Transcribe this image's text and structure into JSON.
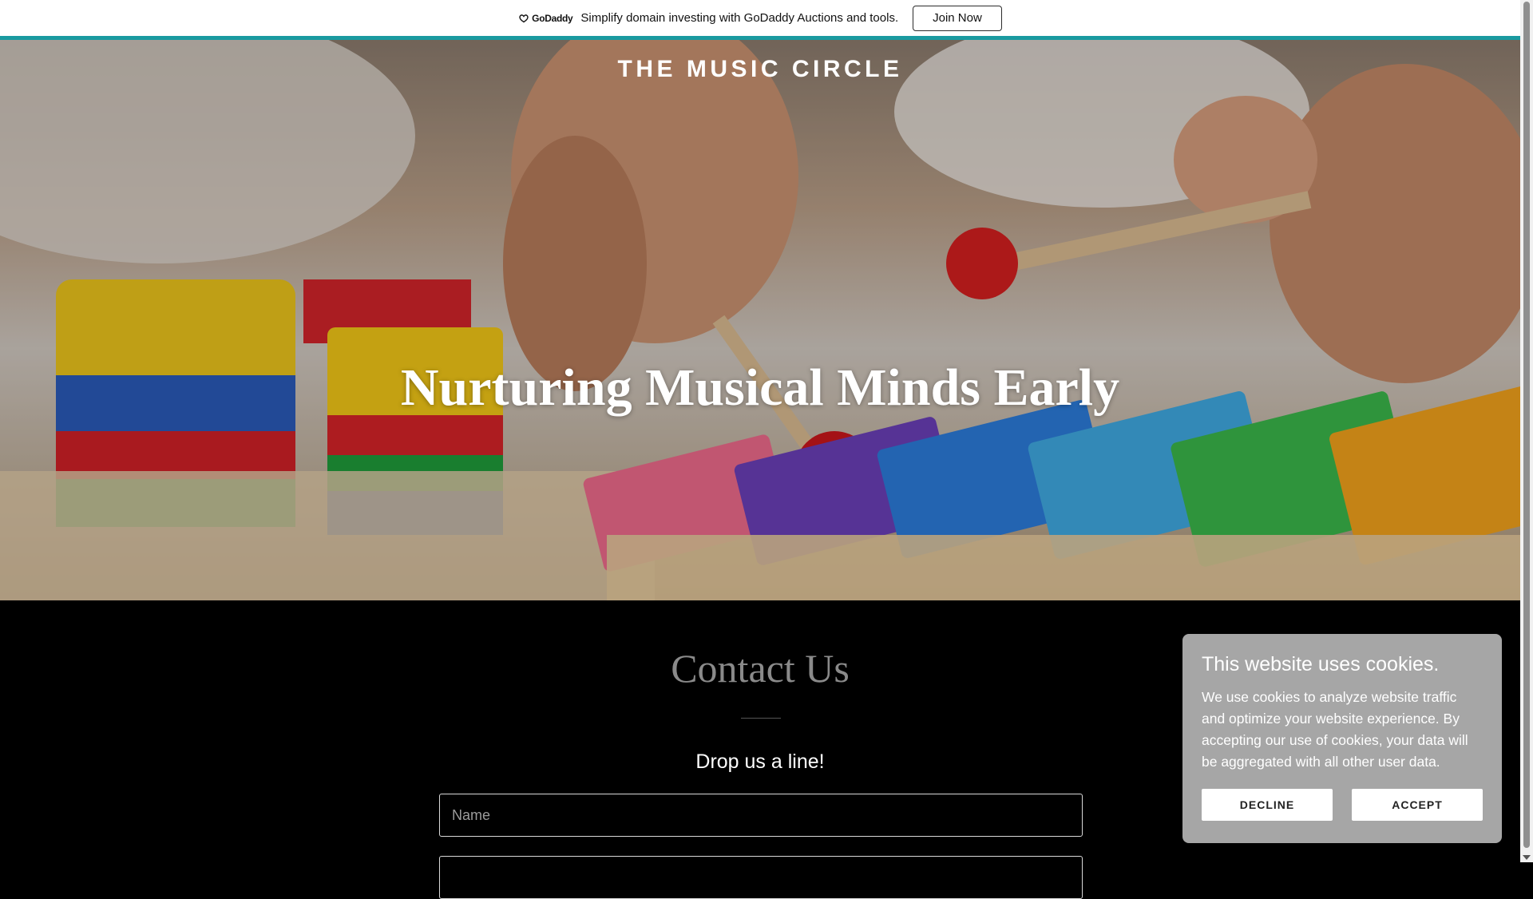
{
  "promo": {
    "logo_text": "GoDaddy",
    "message": "Simplify domain investing with GoDaddy Auctions and tools.",
    "cta_label": "Join Now",
    "accent_color": "#1a9aa0"
  },
  "hero": {
    "site_title": "THE MUSIC CIRCLE",
    "heading": "Nurturing Musical Minds Early"
  },
  "contact": {
    "title": "Contact Us",
    "subtitle": "Drop us a line!",
    "name_placeholder": "Name",
    "email_placeholder": ""
  },
  "cookie": {
    "title": "This website uses cookies.",
    "text": "We use cookies to analyze website traffic and optimize your website experience. By accepting our use of cookies, your data will be aggregated with all other user data.",
    "decline_label": "DECLINE",
    "accept_label": "ACCEPT"
  },
  "icons": {
    "logo": "godaddy-logo-icon",
    "scroll_down": "chevron-down-icon"
  }
}
